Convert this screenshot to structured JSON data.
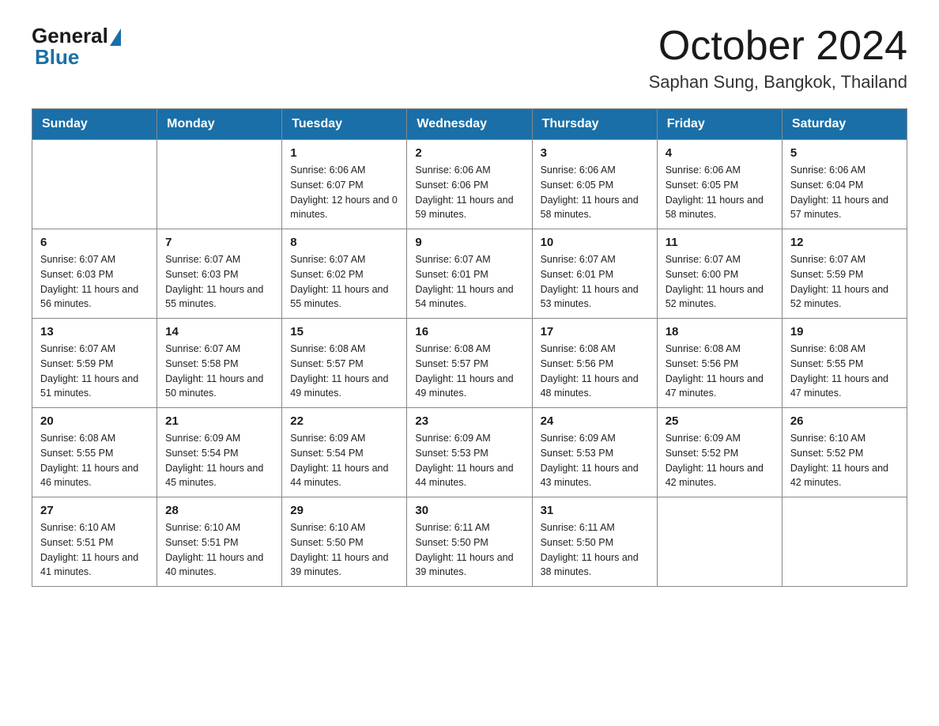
{
  "header": {
    "logo_general": "General",
    "logo_blue": "Blue",
    "title": "October 2024",
    "location": "Saphan Sung, Bangkok, Thailand"
  },
  "weekdays": [
    "Sunday",
    "Monday",
    "Tuesday",
    "Wednesday",
    "Thursday",
    "Friday",
    "Saturday"
  ],
  "weeks": [
    [
      {
        "day": "",
        "info": ""
      },
      {
        "day": "",
        "info": ""
      },
      {
        "day": "1",
        "info": "Sunrise: 6:06 AM\nSunset: 6:07 PM\nDaylight: 12 hours\nand 0 minutes."
      },
      {
        "day": "2",
        "info": "Sunrise: 6:06 AM\nSunset: 6:06 PM\nDaylight: 11 hours\nand 59 minutes."
      },
      {
        "day": "3",
        "info": "Sunrise: 6:06 AM\nSunset: 6:05 PM\nDaylight: 11 hours\nand 58 minutes."
      },
      {
        "day": "4",
        "info": "Sunrise: 6:06 AM\nSunset: 6:05 PM\nDaylight: 11 hours\nand 58 minutes."
      },
      {
        "day": "5",
        "info": "Sunrise: 6:06 AM\nSunset: 6:04 PM\nDaylight: 11 hours\nand 57 minutes."
      }
    ],
    [
      {
        "day": "6",
        "info": "Sunrise: 6:07 AM\nSunset: 6:03 PM\nDaylight: 11 hours\nand 56 minutes."
      },
      {
        "day": "7",
        "info": "Sunrise: 6:07 AM\nSunset: 6:03 PM\nDaylight: 11 hours\nand 55 minutes."
      },
      {
        "day": "8",
        "info": "Sunrise: 6:07 AM\nSunset: 6:02 PM\nDaylight: 11 hours\nand 55 minutes."
      },
      {
        "day": "9",
        "info": "Sunrise: 6:07 AM\nSunset: 6:01 PM\nDaylight: 11 hours\nand 54 minutes."
      },
      {
        "day": "10",
        "info": "Sunrise: 6:07 AM\nSunset: 6:01 PM\nDaylight: 11 hours\nand 53 minutes."
      },
      {
        "day": "11",
        "info": "Sunrise: 6:07 AM\nSunset: 6:00 PM\nDaylight: 11 hours\nand 52 minutes."
      },
      {
        "day": "12",
        "info": "Sunrise: 6:07 AM\nSunset: 5:59 PM\nDaylight: 11 hours\nand 52 minutes."
      }
    ],
    [
      {
        "day": "13",
        "info": "Sunrise: 6:07 AM\nSunset: 5:59 PM\nDaylight: 11 hours\nand 51 minutes."
      },
      {
        "day": "14",
        "info": "Sunrise: 6:07 AM\nSunset: 5:58 PM\nDaylight: 11 hours\nand 50 minutes."
      },
      {
        "day": "15",
        "info": "Sunrise: 6:08 AM\nSunset: 5:57 PM\nDaylight: 11 hours\nand 49 minutes."
      },
      {
        "day": "16",
        "info": "Sunrise: 6:08 AM\nSunset: 5:57 PM\nDaylight: 11 hours\nand 49 minutes."
      },
      {
        "day": "17",
        "info": "Sunrise: 6:08 AM\nSunset: 5:56 PM\nDaylight: 11 hours\nand 48 minutes."
      },
      {
        "day": "18",
        "info": "Sunrise: 6:08 AM\nSunset: 5:56 PM\nDaylight: 11 hours\nand 47 minutes."
      },
      {
        "day": "19",
        "info": "Sunrise: 6:08 AM\nSunset: 5:55 PM\nDaylight: 11 hours\nand 47 minutes."
      }
    ],
    [
      {
        "day": "20",
        "info": "Sunrise: 6:08 AM\nSunset: 5:55 PM\nDaylight: 11 hours\nand 46 minutes."
      },
      {
        "day": "21",
        "info": "Sunrise: 6:09 AM\nSunset: 5:54 PM\nDaylight: 11 hours\nand 45 minutes."
      },
      {
        "day": "22",
        "info": "Sunrise: 6:09 AM\nSunset: 5:54 PM\nDaylight: 11 hours\nand 44 minutes."
      },
      {
        "day": "23",
        "info": "Sunrise: 6:09 AM\nSunset: 5:53 PM\nDaylight: 11 hours\nand 44 minutes."
      },
      {
        "day": "24",
        "info": "Sunrise: 6:09 AM\nSunset: 5:53 PM\nDaylight: 11 hours\nand 43 minutes."
      },
      {
        "day": "25",
        "info": "Sunrise: 6:09 AM\nSunset: 5:52 PM\nDaylight: 11 hours\nand 42 minutes."
      },
      {
        "day": "26",
        "info": "Sunrise: 6:10 AM\nSunset: 5:52 PM\nDaylight: 11 hours\nand 42 minutes."
      }
    ],
    [
      {
        "day": "27",
        "info": "Sunrise: 6:10 AM\nSunset: 5:51 PM\nDaylight: 11 hours\nand 41 minutes."
      },
      {
        "day": "28",
        "info": "Sunrise: 6:10 AM\nSunset: 5:51 PM\nDaylight: 11 hours\nand 40 minutes."
      },
      {
        "day": "29",
        "info": "Sunrise: 6:10 AM\nSunset: 5:50 PM\nDaylight: 11 hours\nand 39 minutes."
      },
      {
        "day": "30",
        "info": "Sunrise: 6:11 AM\nSunset: 5:50 PM\nDaylight: 11 hours\nand 39 minutes."
      },
      {
        "day": "31",
        "info": "Sunrise: 6:11 AM\nSunset: 5:50 PM\nDaylight: 11 hours\nand 38 minutes."
      },
      {
        "day": "",
        "info": ""
      },
      {
        "day": "",
        "info": ""
      }
    ]
  ]
}
